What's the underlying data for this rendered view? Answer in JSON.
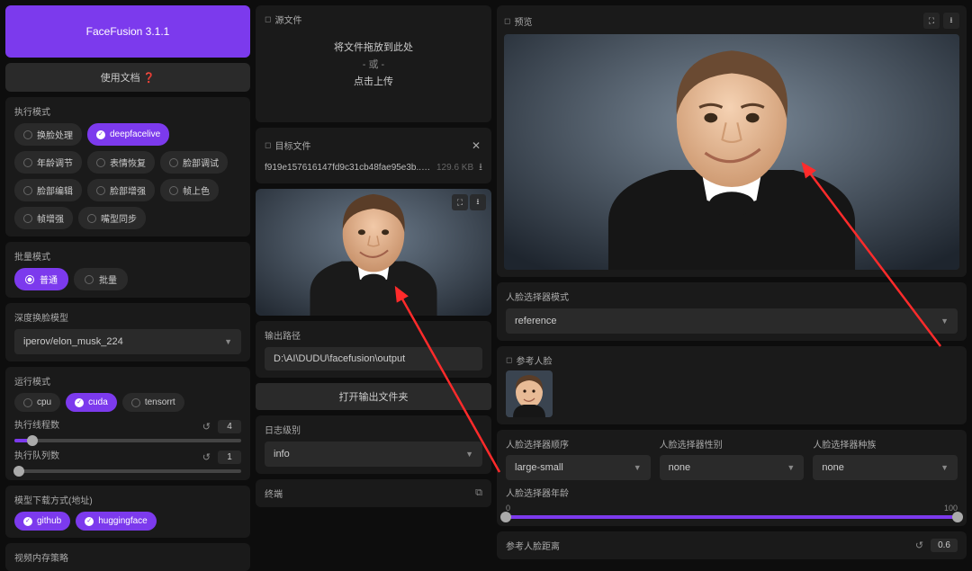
{
  "header": {
    "title": "FaceFusion 3.1.1",
    "docs": "使用文档 ❓"
  },
  "exec_mode": {
    "label": "执行模式",
    "options": [
      {
        "label": "换脸处理",
        "active": false
      },
      {
        "label": "deepfacelive",
        "active": true
      },
      {
        "label": "年龄调节",
        "active": false
      },
      {
        "label": "表情恢复",
        "active": false
      },
      {
        "label": "脸部调试",
        "active": false
      },
      {
        "label": "脸部编辑",
        "active": false
      },
      {
        "label": "脸部增强",
        "active": false
      },
      {
        "label": "帧上色",
        "active": false
      },
      {
        "label": "帧增强",
        "active": false
      },
      {
        "label": "嘴型同步",
        "active": false
      }
    ]
  },
  "batch_mode": {
    "label": "批量模式",
    "options": [
      {
        "label": "普通",
        "active": true
      },
      {
        "label": "批量",
        "active": false
      }
    ]
  },
  "model": {
    "label": "深度换脸模型",
    "value": "iperov/elon_musk_224"
  },
  "run_mode": {
    "label": "运行模式",
    "options": [
      {
        "label": "cpu",
        "active": false
      },
      {
        "label": "cuda",
        "active": true
      },
      {
        "label": "tensorrt",
        "active": false
      }
    ]
  },
  "threads": {
    "label": "执行线程数",
    "value": "4"
  },
  "queue": {
    "label": "执行队列数",
    "value": "1"
  },
  "download": {
    "label": "模型下载方式(地址)",
    "options": [
      {
        "label": "github",
        "active": true
      },
      {
        "label": "huggingface",
        "active": true
      }
    ]
  },
  "vram": {
    "label": "视频内存策略"
  },
  "source": {
    "label": "源文件",
    "drop1": "将文件拖放到此处",
    "drop2": "- 或 -",
    "drop3": "点击上传"
  },
  "target": {
    "label": "目标文件",
    "filename": "f919e157616147fd9c31cb48fae95e3b... .jpeg",
    "filesize": "129.6 KB"
  },
  "output_path": {
    "label": "输出路径",
    "value": "D:\\AI\\DUDU\\facefusion\\output"
  },
  "open_output": "打开输出文件夹",
  "log_level": {
    "label": "日志级别",
    "value": "info"
  },
  "terminal": {
    "label": "终端"
  },
  "preview": {
    "label": "预览"
  },
  "face_selector_mode": {
    "label": "人脸选择器模式",
    "value": "reference"
  },
  "reference_face": {
    "label": "参考人脸"
  },
  "face_order": {
    "label": "人脸选择器顺序",
    "value": "large-small"
  },
  "face_gender": {
    "label": "人脸选择器性别",
    "value": "none"
  },
  "face_race": {
    "label": "人脸选择器种族",
    "value": "none"
  },
  "face_age": {
    "label": "人脸选择器年龄",
    "min": "0",
    "max": "100"
  },
  "ref_distance": {
    "label": "参考人脸距离",
    "value": "0.6"
  }
}
